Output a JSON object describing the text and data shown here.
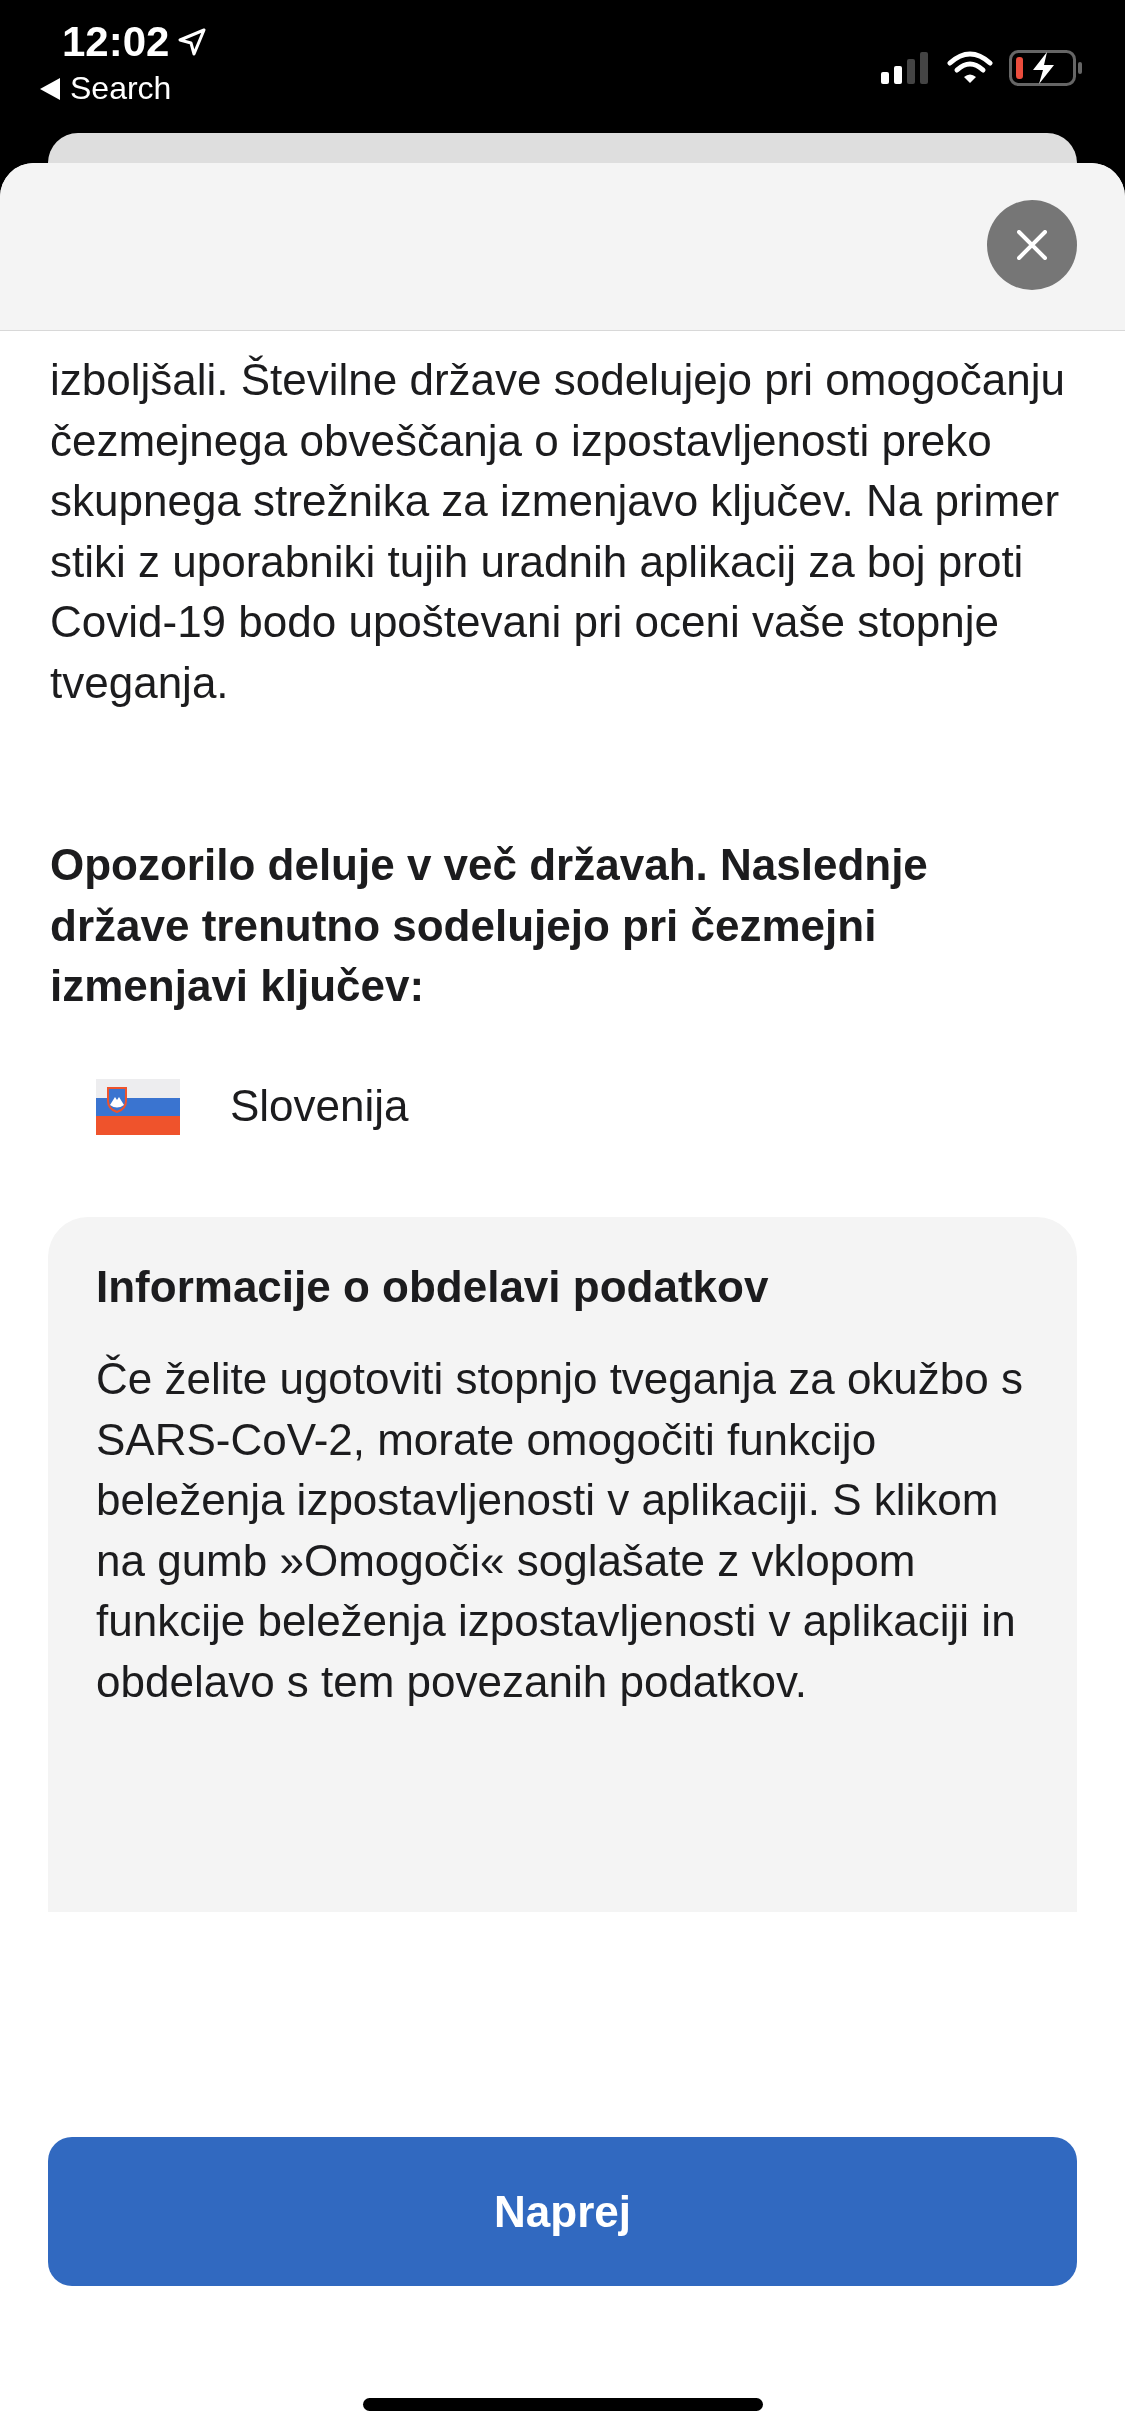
{
  "status_bar": {
    "time": "12:02",
    "back_label": "Search"
  },
  "intro": "izboljšali. Številne države sodelujejo pri omogočanju čezmejnega obveščanja o izpostavljenosti preko skupnega strežnika za izmenjavo ključev. Na primer stiki z uporabniki tujih uradnih aplikacij za boj proti Covid-19 bodo upoštevani pri oceni vaše stopnje tveganja.",
  "heading": "Opozorilo deluje v več državah. Naslednje države trenutno sodelujejo pri čezmejni izmenjavi ključev:",
  "countries": [
    {
      "name": "Slovenija"
    }
  ],
  "info_card": {
    "title": "Informacije o obdelavi podatkov",
    "text": "Če želite ugotoviti stopnjo tveganja za okužbo s SARS-CoV-2, morate omogočiti funkcijo beleženja izpostavljenosti v aplikaciji. S klikom na gumb »Omogoči« soglašate z vklopom funkcije beleženja izpostavljenosti v aplikaciji in obdelavo s tem povezanih podatkov."
  },
  "button": {
    "label": "Naprej"
  }
}
